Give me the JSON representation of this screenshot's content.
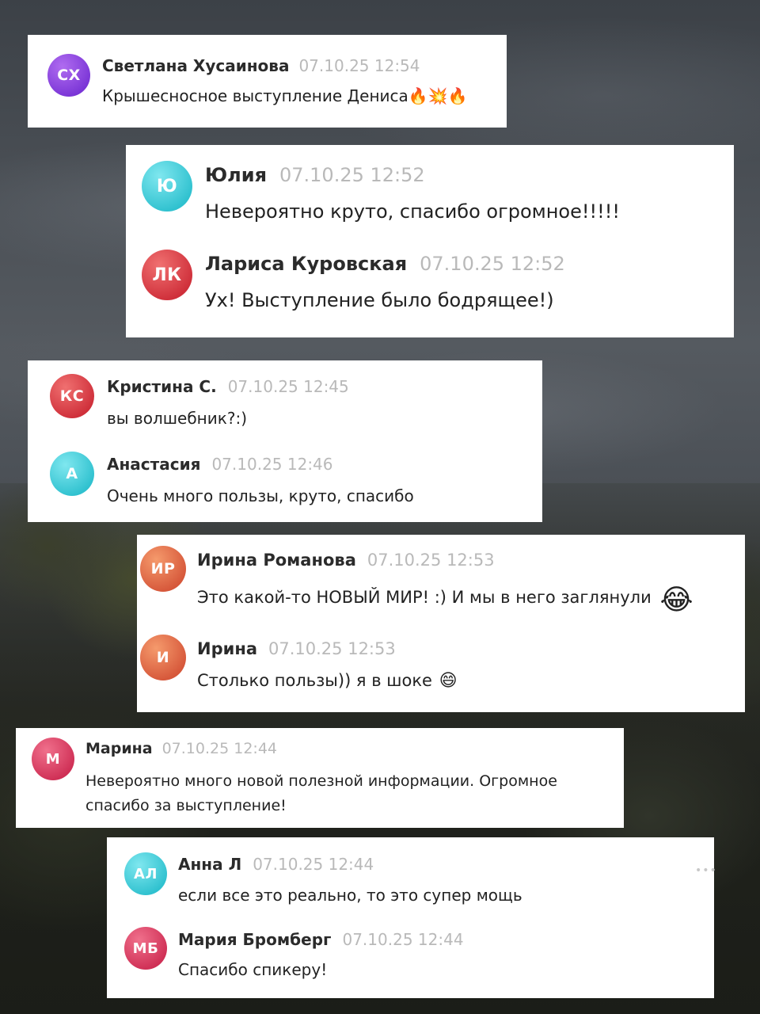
{
  "cards": [
    {
      "messages": [
        {
          "initials": "СХ",
          "name": "Светлана Хусаинова",
          "time": "07.10.25 12:54",
          "text": "Крышесносное выступление Дениса🔥💥🔥"
        }
      ]
    },
    {
      "messages": [
        {
          "initials": "Ю",
          "name": "Юлия",
          "time": "07.10.25 12:52",
          "text": "Невероятно круто, спасибо огромное!!!!!"
        },
        {
          "initials": "ЛК",
          "name": "Лариса Куровская",
          "time": "07.10.25 12:52",
          "text": "Ух! Выступление было бодрящее!)"
        }
      ]
    },
    {
      "messages": [
        {
          "initials": "КС",
          "name": "Кристина С.",
          "time": "07.10.25 12:45",
          "text": "вы волшебник?:)"
        },
        {
          "initials": "А",
          "name": "Анастасия",
          "time": "07.10.25 12:46",
          "text": "Очень много пользы, круто, спасибо"
        }
      ]
    },
    {
      "messages": [
        {
          "initials": "ИР",
          "name": "Ирина Романова",
          "time": "07.10.25 12:53",
          "text": "Это какой-то НОВЫЙ МИР! :) И мы в него заглянули",
          "emoji": "😂"
        },
        {
          "initials": "И",
          "name": "Ирина",
          "time": "07.10.25 12:53",
          "text": "Столько пользы)) я в шоке",
          "emoji": "😄"
        }
      ]
    },
    {
      "messages": [
        {
          "initials": "М",
          "name": "Марина",
          "time": "07.10.25 12:44",
          "text_line1": "Невероятно много новой полезной информации. Огромное",
          "text_line2": "спасибо за выступление!"
        }
      ]
    },
    {
      "messages": [
        {
          "initials": "АЛ",
          "name": "Анна Л",
          "time": "07.10.25 12:44",
          "text": "если все это реально, то это супер мощь"
        },
        {
          "initials": "МБ",
          "name": "Мария Бромберг",
          "time": "07.10.25 12:44",
          "text": "Спасибо спикеру!"
        }
      ],
      "more_glyph": "•••"
    }
  ]
}
